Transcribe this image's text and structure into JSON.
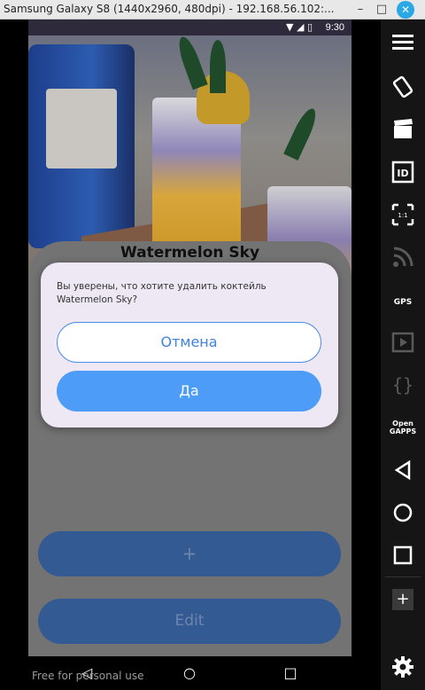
{
  "window": {
    "title": "Samsung Galaxy S8 (1440x2960, 480dpi) - 192.168.56.102:...",
    "minimize": "–",
    "maximize": "□",
    "close": "✕"
  },
  "statusbar": {
    "icons": "▼ ◢ ▯",
    "time": "9:30"
  },
  "drink": {
    "name": "Watermelon Sky"
  },
  "dialog": {
    "message": "Вы уверены, что хотите удалить коктейль Watermelon Sky?",
    "cancel_label": "Отмена",
    "confirm_label": "Да"
  },
  "actions": {
    "add_label": "+",
    "edit_label": "Edit"
  },
  "navbar": {
    "back": "◁",
    "home": "○",
    "recent": "□"
  },
  "watermark": "Free for personal use",
  "toolbar": {
    "id_label": "ID",
    "gps_label": "GPS",
    "open_gapps_label": "Open\nGAPPS",
    "plus_label": "+"
  },
  "colors": {
    "accent": "#4d9cf8",
    "cancel_border": "#4a8eea",
    "dialog_bg": "#ede8f4",
    "action_button": "#335a93"
  }
}
